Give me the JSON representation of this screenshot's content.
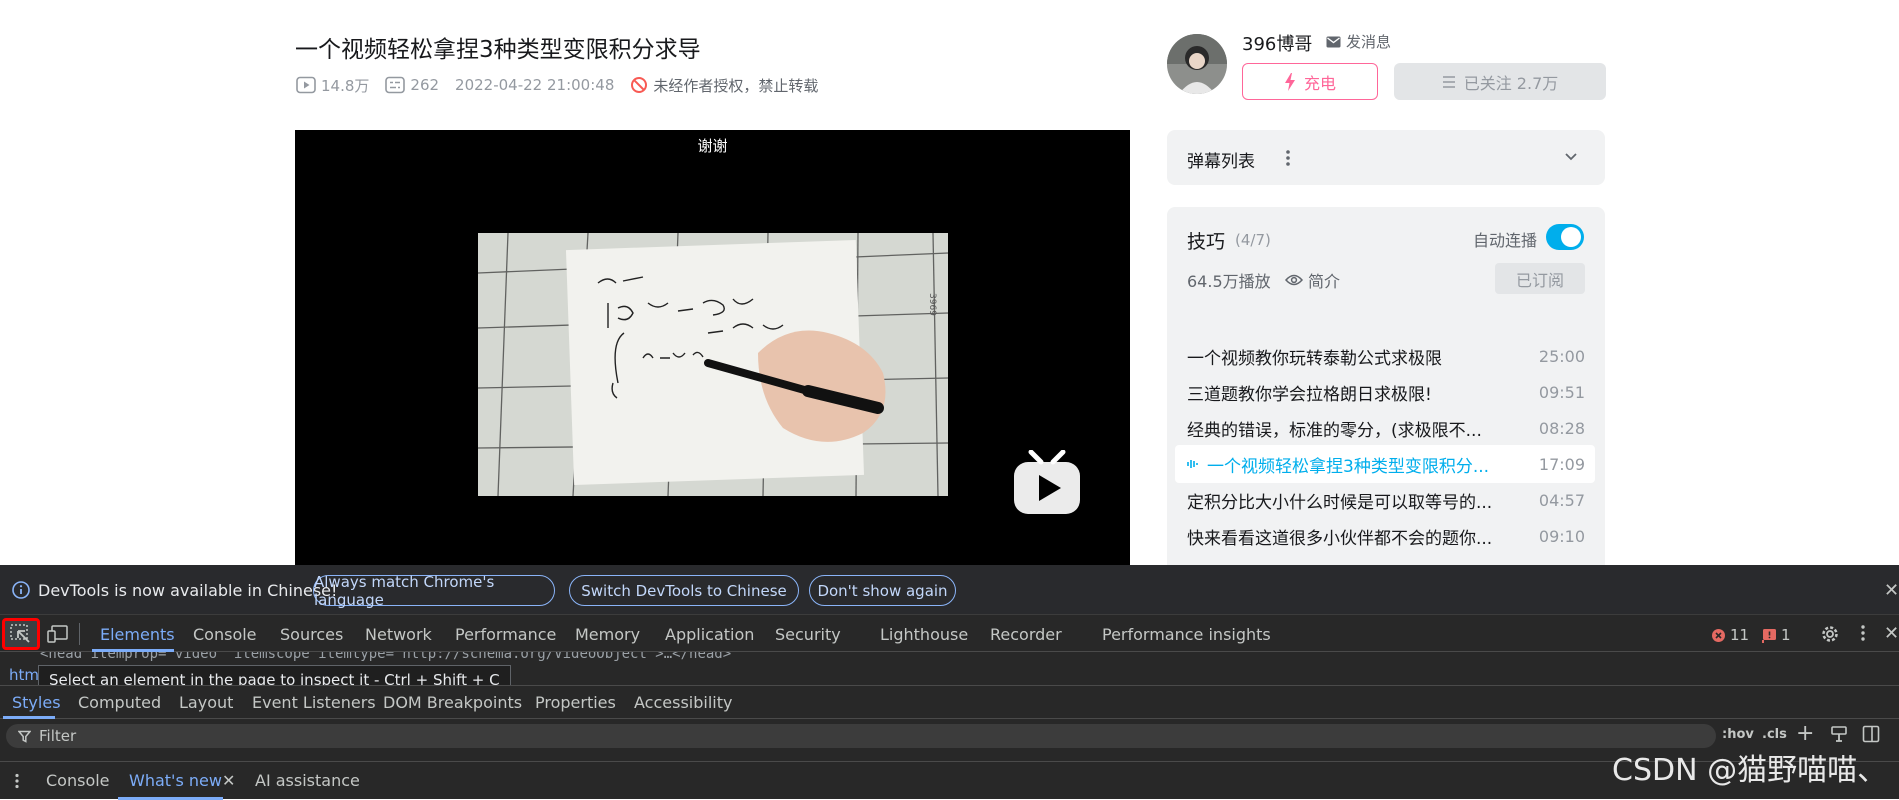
{
  "video": {
    "title": "一个视频轻松拿捏3种类型变限积分求导",
    "views": "14.8万",
    "danmaku_count": "262",
    "publish_time": "2022-04-22 21:00:48",
    "copyright_notice": "未经作者授权，禁止转载",
    "subtitle": "谢谢"
  },
  "uploader": {
    "name": "396博哥",
    "message_label": "发消息",
    "charge_label": "充电",
    "follow_label": "已关注 2.7万"
  },
  "danmaku_panel": {
    "label": "弹幕列表"
  },
  "playlist": {
    "title": "技巧",
    "count": "(4/7)",
    "autoplay_label": "自动连播",
    "autoplay_on": true,
    "plays": "64.5万播放",
    "intro_label": "简介",
    "subscribed_label": "已订阅",
    "items": [
      {
        "title": "一个视频教你玩转泰勒公式求极限",
        "duration": "25:00"
      },
      {
        "title": "三道题教你学会拉格朗日求极限!",
        "duration": "09:51"
      },
      {
        "title": "经典的错误，标准的零分，(求极限不...",
        "duration": "08:28"
      },
      {
        "title": "一个视频轻松拿捏3种类型变限积分...",
        "duration": "17:09"
      },
      {
        "title": "定积分比大小什么时候是可以取等号的...",
        "duration": "04:57"
      },
      {
        "title": "快来看看这道很多小伙伴都不会的题你...",
        "duration": "09:10"
      }
    ]
  },
  "devtools": {
    "infobar": {
      "text": "DevTools is now available in Chinese!",
      "btn_match": "Always match Chrome's language",
      "btn_switch": "Switch DevTools to Chinese",
      "btn_dismiss": "Don't show again"
    },
    "tabs": [
      "Elements",
      "Console",
      "Sources",
      "Network",
      "Performance",
      "Memory",
      "Application",
      "Security",
      "Lighthouse",
      "Recorder",
      "Performance insights"
    ],
    "active_tab": "Elements",
    "error_count": "11",
    "issue_count": "1",
    "code_line": "<head itemprop=\"video\" itemscope itemtype=\"http://schema.org/VideoObject\">…</head>",
    "breadcrumb": "html",
    "tooltip": "Select an element in the page to inspect it - Ctrl + Shift + C",
    "style_tabs": [
      "Styles",
      "Computed",
      "Layout",
      "Event Listeners",
      "DOM Breakpoints",
      "Properties",
      "Accessibility"
    ],
    "filter_placeholder": "Filter",
    "hov_label": ":hov",
    "cls_label": ".cls",
    "drawer_tabs": [
      "Console",
      "What's new",
      "AI assistance"
    ]
  },
  "watermark": "CSDN @猫野喵喵、",
  "colors": {
    "accent_blue": "#00aeec",
    "pink": "#ff6699",
    "devtools_blue": "#7cacf8",
    "inspect_highlight": "#ff0000"
  }
}
